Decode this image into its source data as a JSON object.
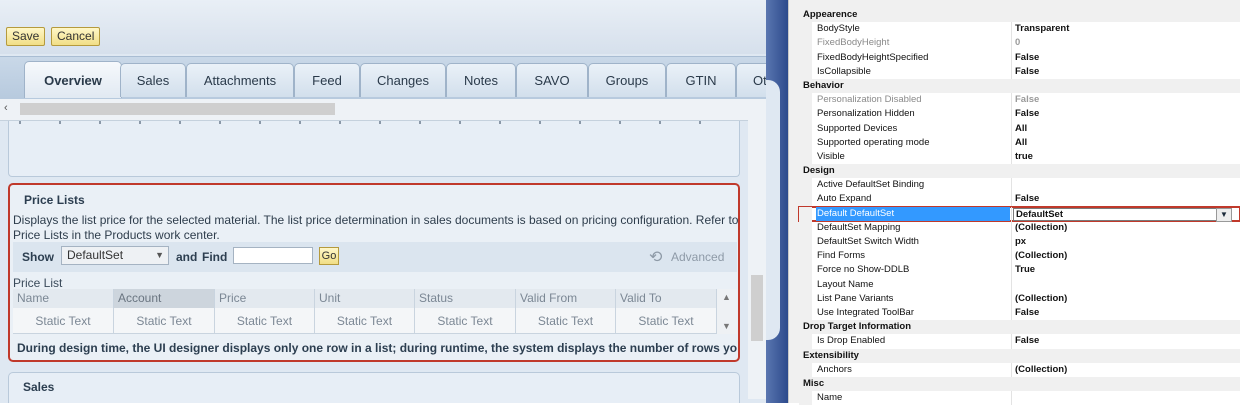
{
  "toolbar": {
    "save_label": "Save",
    "cancel_label": "Cancel"
  },
  "tabs": [
    "Overview",
    "Sales",
    "Attachments",
    "Feed",
    "Changes",
    "Notes",
    "SAVO",
    "Groups",
    "GTIN",
    "Ot"
  ],
  "price_lists": {
    "title": "Price Lists",
    "description_line1": "Displays the list price for the selected material. The list price determination in sales documents is based on pricing configuration. Refer to",
    "description_line2": "Price Lists in the Products work center.",
    "show_label": "Show",
    "show_value": "DefaultSet",
    "and_find_label": "and",
    "find_label": "Find",
    "find_value": "",
    "go_label": "Go",
    "advanced_label": "Advanced",
    "list_label": "Price List",
    "columns": [
      "Name",
      "Account",
      "Price",
      "Unit",
      "Status",
      "Valid From",
      "Valid To"
    ],
    "row": [
      "Static Text",
      "Static Text",
      "Static Text",
      "Static Text",
      "Static Text",
      "Static Text",
      "Static Text"
    ],
    "note": "During design time, the UI designer displays only one row in a list; during runtime, the system displays the number of rows yo"
  },
  "sales": {
    "title": "Sales"
  },
  "properties": [
    {
      "type": "cat",
      "name": "Appearence"
    },
    {
      "type": "prop",
      "name": "BodyStyle",
      "value": "Transparent"
    },
    {
      "type": "dis",
      "name": "FixedBodyHeight",
      "value": "0"
    },
    {
      "type": "prop",
      "name": "FixedBodyHeightSpecified",
      "value": "False"
    },
    {
      "type": "prop",
      "name": "IsCollapsible",
      "value": "False"
    },
    {
      "type": "cat",
      "name": "Behavior"
    },
    {
      "type": "dis",
      "name": "Personalization Disabled",
      "value": "False"
    },
    {
      "type": "prop",
      "name": "Personalization Hidden",
      "value": "False"
    },
    {
      "type": "prop",
      "name": "Supported Devices",
      "value": "All"
    },
    {
      "type": "prop",
      "name": "Supported operating mode",
      "value": "All"
    },
    {
      "type": "prop",
      "name": "Visible",
      "value": "true"
    },
    {
      "type": "cat",
      "name": "Design"
    },
    {
      "type": "prop",
      "name": "Active DefaultSet Binding",
      "value": ""
    },
    {
      "type": "prop",
      "name": "Auto Expand",
      "value": "False"
    },
    {
      "type": "sel",
      "name": "Default DefaultSet",
      "value": "DefaultSet"
    },
    {
      "type": "prop",
      "name": "DefaultSet Mapping",
      "value": "(Collection)"
    },
    {
      "type": "prop",
      "name": "DefaultSet Switch Width",
      "value": "px"
    },
    {
      "type": "prop",
      "name": "Find Forms",
      "value": "(Collection)"
    },
    {
      "type": "prop",
      "name": "Force no Show-DDLB",
      "value": "True"
    },
    {
      "type": "prop",
      "name": "Layout Name",
      "value": ""
    },
    {
      "type": "prop",
      "name": "List Pane Variants",
      "value": "(Collection)"
    },
    {
      "type": "prop",
      "name": "Use Integrated ToolBar",
      "value": "False"
    },
    {
      "type": "cat",
      "name": "Drop Target Information"
    },
    {
      "type": "prop",
      "name": "Is Drop Enabled",
      "value": "False"
    },
    {
      "type": "cat",
      "name": "Extensibility"
    },
    {
      "type": "prop",
      "name": "Anchors",
      "value": "(Collection)"
    },
    {
      "type": "cat",
      "name": "Misc"
    },
    {
      "type": "prop",
      "name": "Name",
      "value": ""
    }
  ]
}
